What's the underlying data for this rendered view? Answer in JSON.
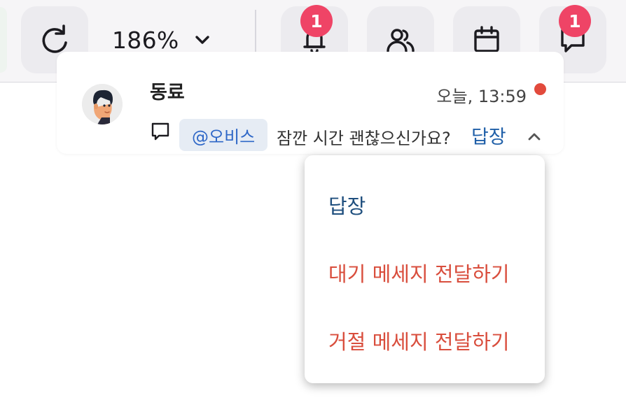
{
  "toolbar": {
    "zoom_value": "186%",
    "notification_badge": "1",
    "messages_badge": "1"
  },
  "notification": {
    "sender": "동료",
    "timestamp": "오늘, 13:59",
    "mention": "@오비스",
    "message": "잠깐 시간 괜찮으신가요?",
    "reply_label": "답장"
  },
  "menu": {
    "items": [
      {
        "label": "답장"
      },
      {
        "label": "대기 메세지 전달하기"
      },
      {
        "label": "거절 메세지 전달하기"
      }
    ]
  },
  "colors": {
    "badge": "#ef4466",
    "unread": "#e24a3c",
    "link": "#1f5fa8",
    "danger": "#d94e3d",
    "mention_bg": "#e6ecf4"
  }
}
